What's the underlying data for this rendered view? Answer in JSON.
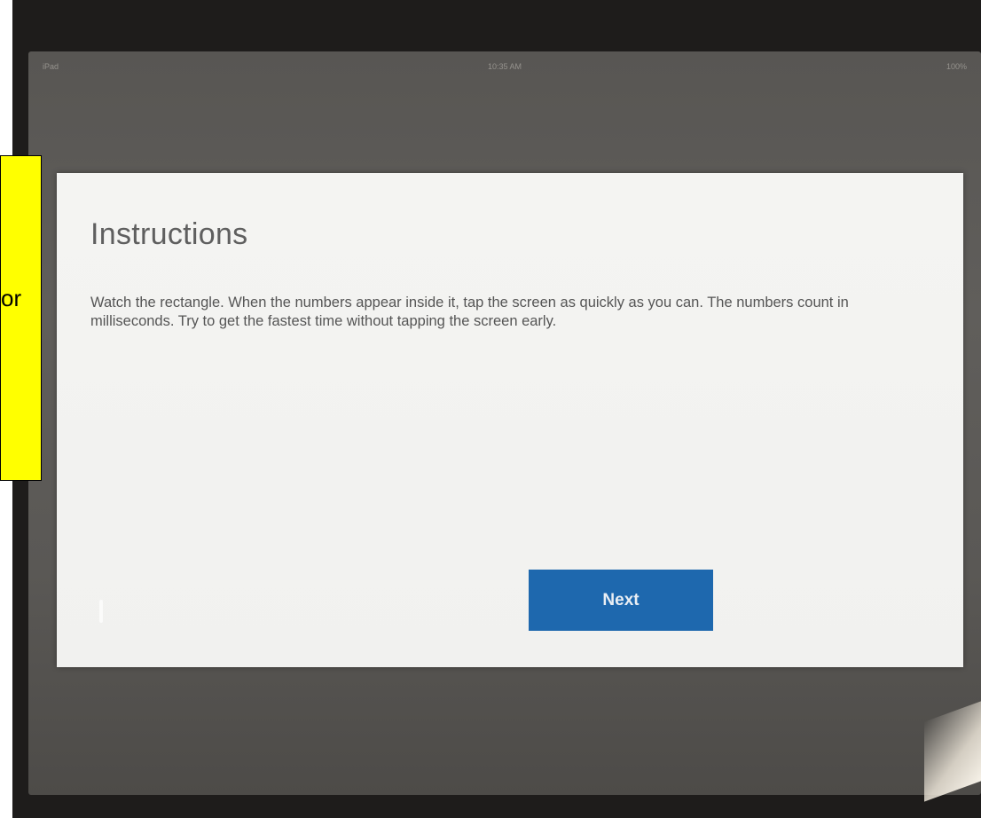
{
  "status_bar": {
    "left": "iPad",
    "center": "10:35 AM",
    "right": "100%"
  },
  "dialog": {
    "title": "Instructions",
    "body": "Watch the rectangle. When the numbers appear inside it, tap the screen as quickly as you can. The numbers count in milliseconds. Try to get the fastest time without tapping the screen early.",
    "next_label": "Next"
  },
  "callout": {
    "text": "or"
  },
  "colors": {
    "button": "#1e68ae",
    "card": "#f3f3f1",
    "callout": "#ffff00"
  }
}
